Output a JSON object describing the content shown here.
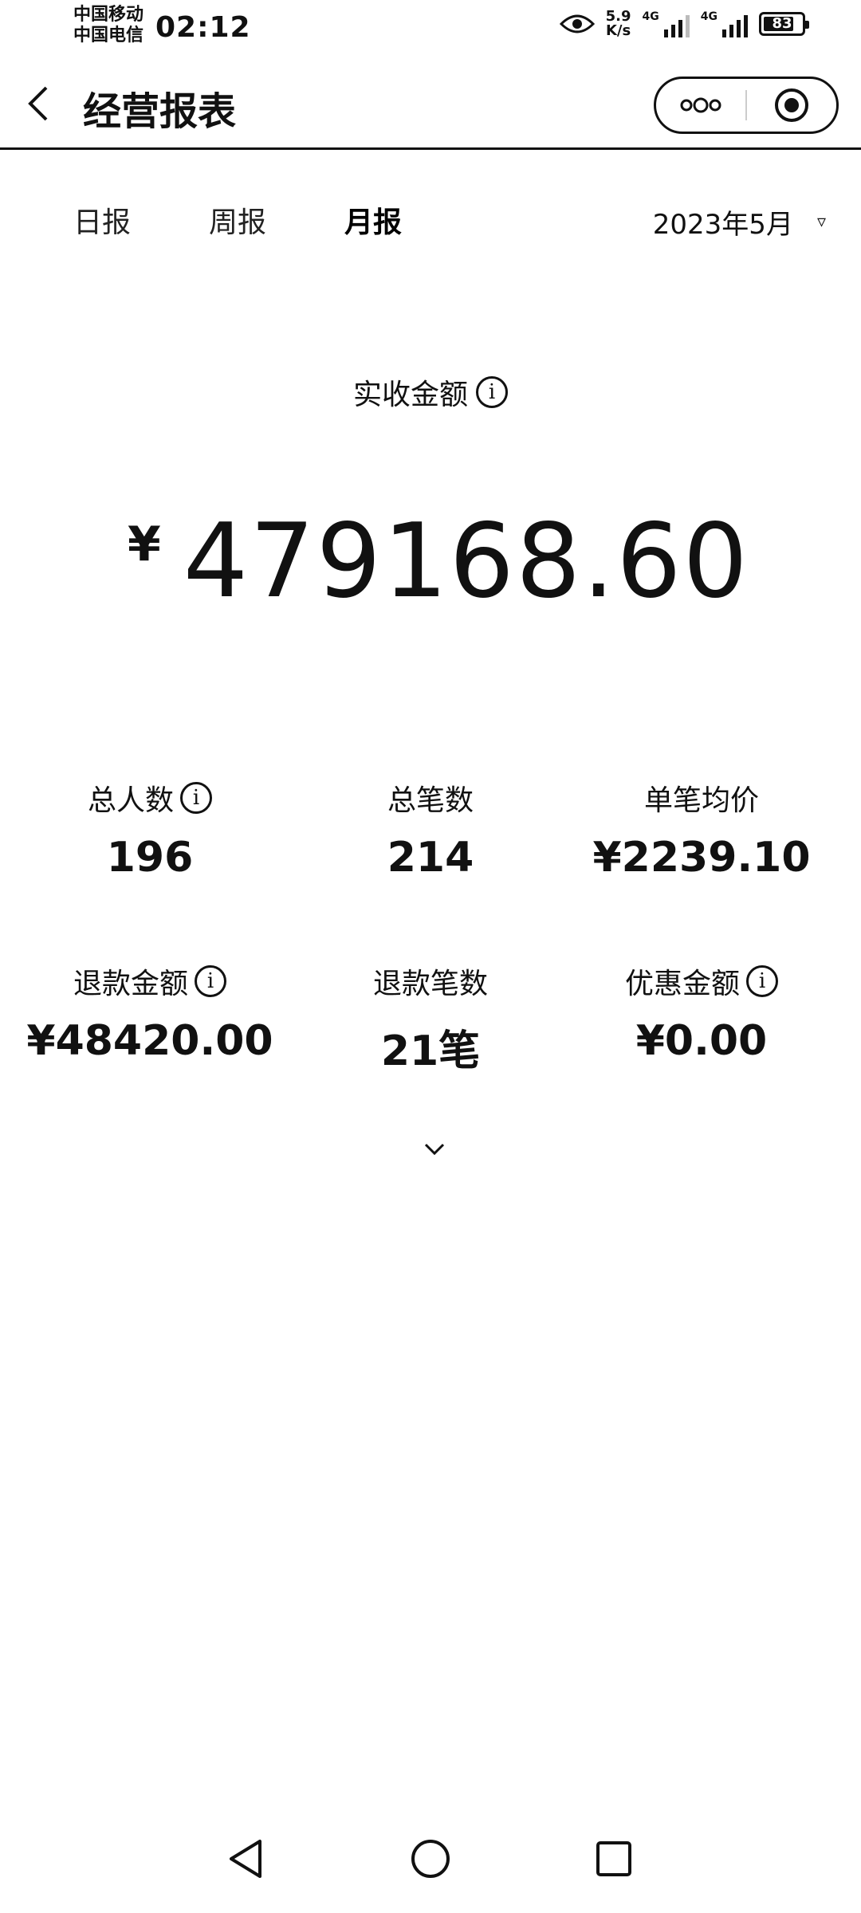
{
  "status_bar": {
    "carrier_1": "中国移动",
    "carrier_2": "中国电信",
    "time": "02:12",
    "net_speed_value": "5.9",
    "net_speed_unit": "K/s",
    "sim1_network": "4G",
    "sim2_network": "4G",
    "battery": "83",
    "battery_level": 0.83
  },
  "nav": {
    "title": "经营报表",
    "more_icon": "more-dots-icon",
    "close_icon": "target-close-icon"
  },
  "tabs": [
    {
      "label": "日报",
      "active": false
    },
    {
      "label": "周报",
      "active": false
    },
    {
      "label": "月报",
      "active": true
    }
  ],
  "period": {
    "value": "2023年5月",
    "caret": "▿"
  },
  "summary": {
    "label": "实收金额",
    "currency": "¥",
    "amount": "479168.60"
  },
  "stats": [
    {
      "label": "总人数",
      "value": "196",
      "info": true
    },
    {
      "label": "总笔数",
      "value": "214",
      "info": false
    },
    {
      "label": "单笔均价",
      "value": "¥2239.10",
      "info": false
    },
    {
      "label": "退款金额",
      "value": "¥48420.00",
      "info": true
    },
    {
      "label": "退款笔数",
      "value": "21笔",
      "info": false
    },
    {
      "label": "优惠金额",
      "value": "¥0.00",
      "info": true
    }
  ],
  "icons": {
    "info": "i"
  }
}
